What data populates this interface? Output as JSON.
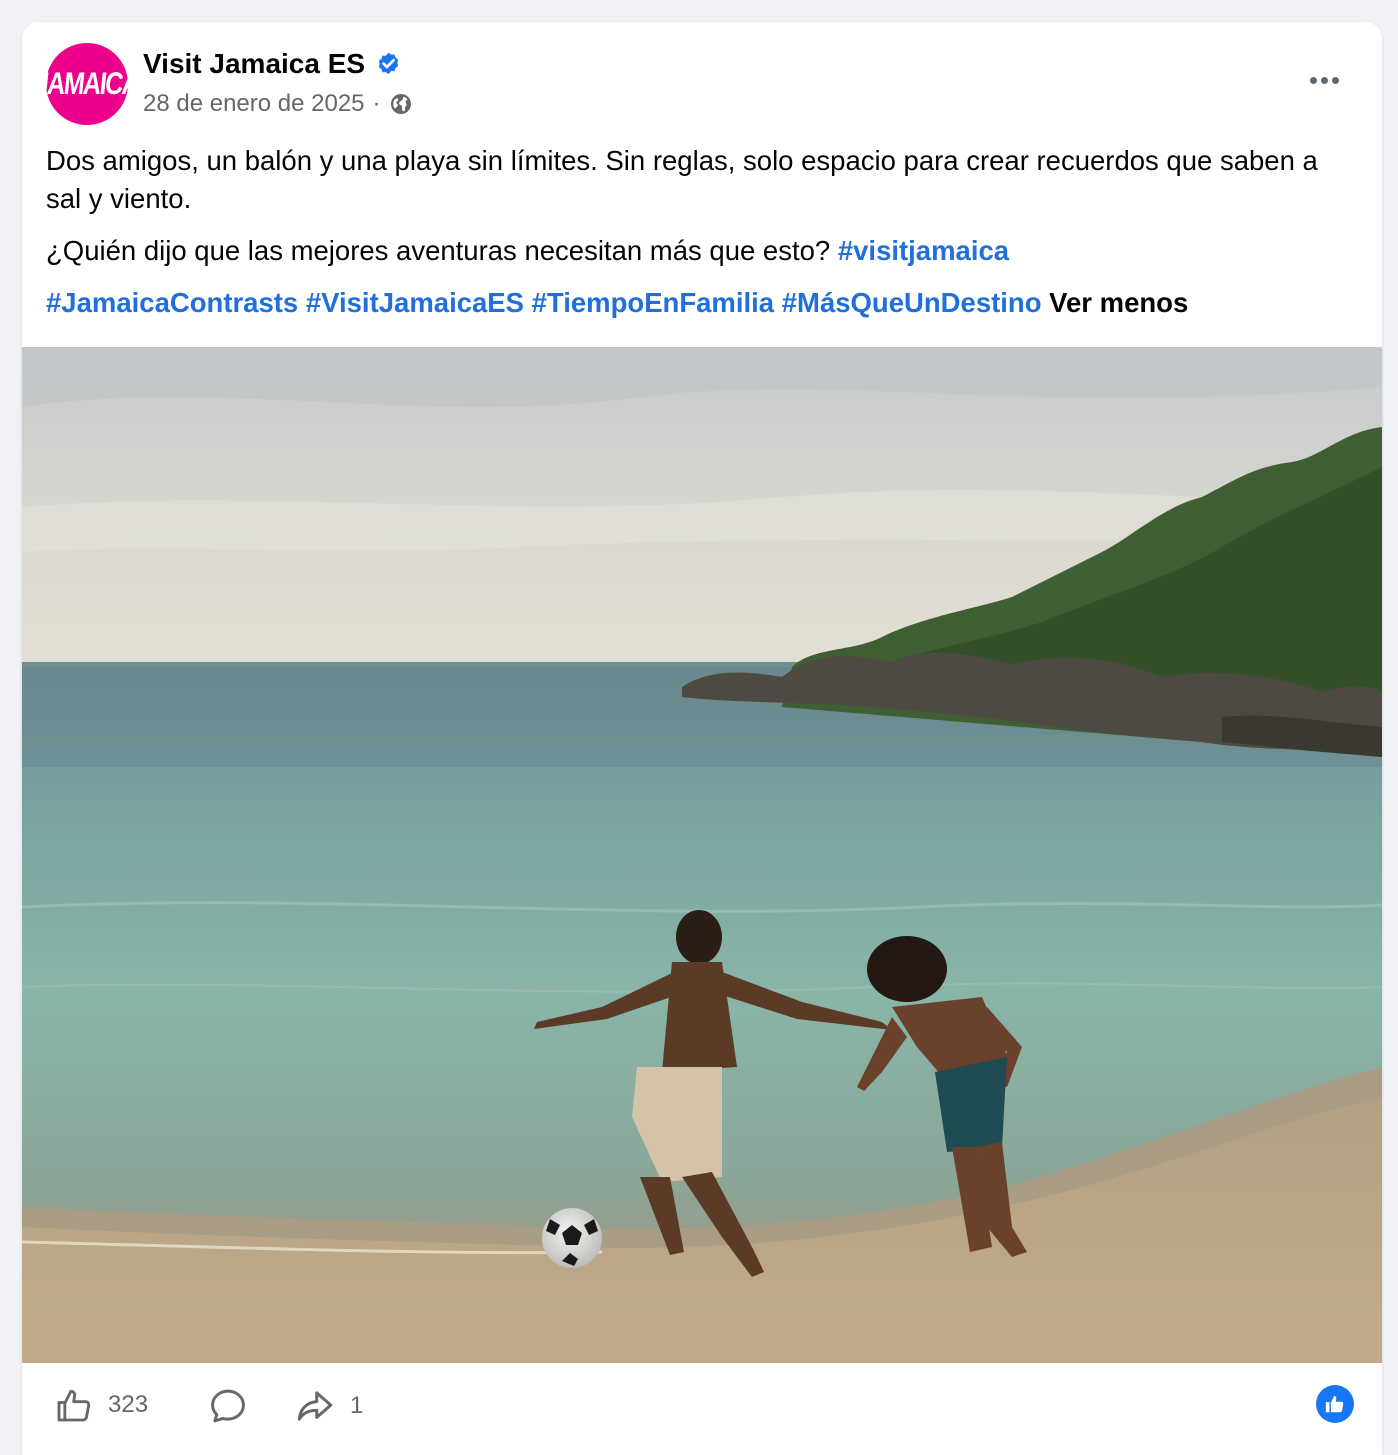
{
  "post": {
    "avatar_text": "JAMAICA",
    "page_name": "Visit Jamaica ES",
    "date": "28 de enero de 2025",
    "separator": "·",
    "paragraph1": "Dos amigos, un balón y una playa sin límites. Sin reglas, solo espacio para crear recuerdos que saben a sal y viento.",
    "paragraph2_text": "¿Quién dijo que las mejores aventuras necesitan más que esto?",
    "paragraph2_tag": "#visitjamaica",
    "hashtags": [
      "#JamaicaContrasts",
      "#VisitJamaicaES",
      "#TiempoEnFamilia",
      "#MásQueUnDestino"
    ],
    "see_less": "Ver menos"
  },
  "stats": {
    "likes": "323",
    "shares": "1"
  },
  "icons": {
    "verified": "verified-badge-icon",
    "privacy": "globe-icon",
    "more": "more-options-icon",
    "like": "thumbs-up-icon",
    "comment": "comment-icon",
    "share": "share-icon",
    "reaction": "like-reaction-icon"
  },
  "colors": {
    "brand": "#ec008c",
    "link": "#216fdb",
    "facebook_blue": "#1877f2",
    "muted": "#65676b"
  }
}
